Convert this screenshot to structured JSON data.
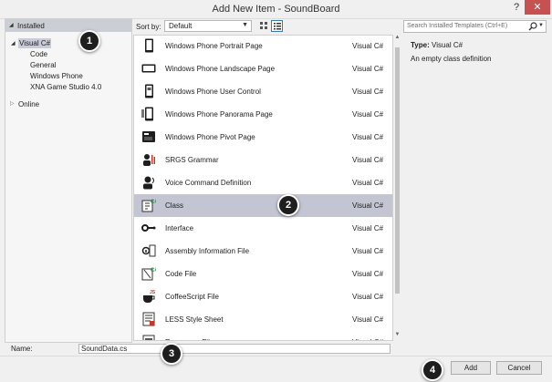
{
  "window": {
    "title": "Add New Item - SoundBoard",
    "help_glyph": "?",
    "close_glyph": "✕"
  },
  "tree": {
    "installed": "Installed",
    "visual_csharp": "Visual C#",
    "children": [
      "Code",
      "General",
      "Windows Phone",
      "XNA Game Studio 4.0"
    ],
    "online": "Online"
  },
  "toolbar": {
    "sort_label": "Sort by:",
    "sort_value": "Default"
  },
  "templates": [
    {
      "name": "Windows Phone Portrait Page",
      "lang": "Visual C#",
      "icon": "portrait-page-icon"
    },
    {
      "name": "Windows Phone Landscape Page",
      "lang": "Visual C#",
      "icon": "landscape-page-icon"
    },
    {
      "name": "Windows Phone User Control",
      "lang": "Visual C#",
      "icon": "user-control-icon"
    },
    {
      "name": "Windows Phone Panorama Page",
      "lang": "Visual C#",
      "icon": "panorama-page-icon"
    },
    {
      "name": "Windows Phone Pivot Page",
      "lang": "Visual C#",
      "icon": "pivot-page-icon"
    },
    {
      "name": "SRGS Grammar",
      "lang": "Visual C#",
      "icon": "srgs-grammar-icon"
    },
    {
      "name": "Voice Command Definition",
      "lang": "Visual C#",
      "icon": "voice-command-icon"
    },
    {
      "name": "Class",
      "lang": "Visual C#",
      "icon": "class-icon"
    },
    {
      "name": "Interface",
      "lang": "Visual C#",
      "icon": "interface-icon"
    },
    {
      "name": "Assembly Information File",
      "lang": "Visual C#",
      "icon": "assembly-info-icon"
    },
    {
      "name": "Code File",
      "lang": "Visual C#",
      "icon": "code-file-icon"
    },
    {
      "name": "CoffeeScript File",
      "lang": "Visual C#",
      "icon": "coffeescript-icon"
    },
    {
      "name": "LESS Style Sheet",
      "lang": "Visual C#",
      "icon": "less-stylesheet-icon"
    },
    {
      "name": "Resources File",
      "lang": "Visual C#",
      "icon": "resources-file-icon"
    }
  ],
  "selected_index": 7,
  "search": {
    "placeholder": "Search Installed Templates (Ctrl+E)"
  },
  "details": {
    "type_label": "Type:",
    "type_value": "Visual C#",
    "description": "An empty class definition"
  },
  "name_field": {
    "label": "Name:",
    "value": "SoundData.cs"
  },
  "buttons": {
    "add": "Add",
    "cancel": "Cancel"
  },
  "callouts": [
    "1",
    "2",
    "3",
    "4"
  ],
  "colors": {
    "selection": "#c3c6d2",
    "close_button": "#c75050",
    "callout": "#1e1e1e"
  }
}
